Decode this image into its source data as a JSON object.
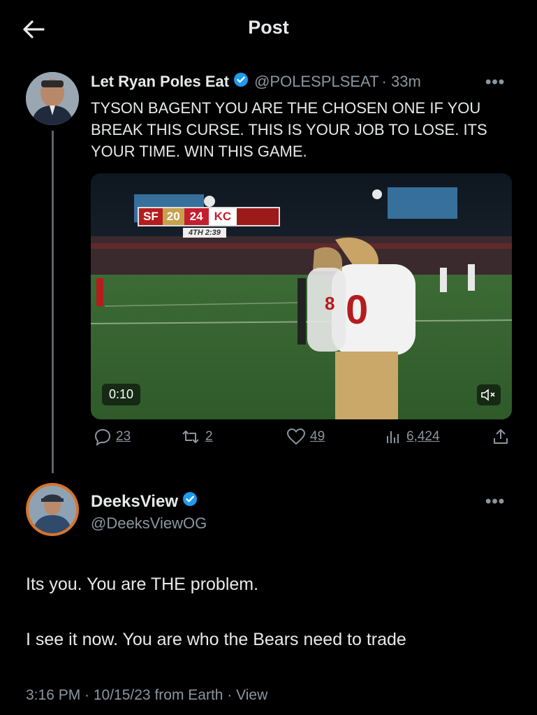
{
  "header": {
    "title": "Post"
  },
  "quoted_post": {
    "author_name": "Let Ryan Poles Eat",
    "handle": "@POLESPLSEAT",
    "time": "· 33m",
    "more": "•••",
    "text": "TYSON BAGENT YOU ARE THE CHOSEN ONE IF YOU BREAK THIS CURSE. THIS IS YOUR JOB TO LOSE. ITS YOUR TIME. WIN THIS GAME.",
    "video": {
      "duration": "0:10",
      "score_team1": "SF",
      "score_value1": "20",
      "score_value2": "24",
      "score_team2": "KC",
      "clock": "4TH   2:39"
    },
    "stats": {
      "replies": "23",
      "reposts": "2",
      "likes": "49",
      "views": "6,424"
    }
  },
  "reply_post": {
    "author_name": "DeeksView",
    "handle": "@DeeksViewOG",
    "more": "•••",
    "line1": "Its you. You are THE problem.",
    "line2": "I see it now. You are who the Bears need to trade",
    "meta": "3:16 PM · 10/15/23 from Earth · View"
  },
  "colors": {
    "background": "#000000",
    "text": "#e7e9ea",
    "muted": "#8b96a0",
    "verified": "#1d9bf0"
  }
}
